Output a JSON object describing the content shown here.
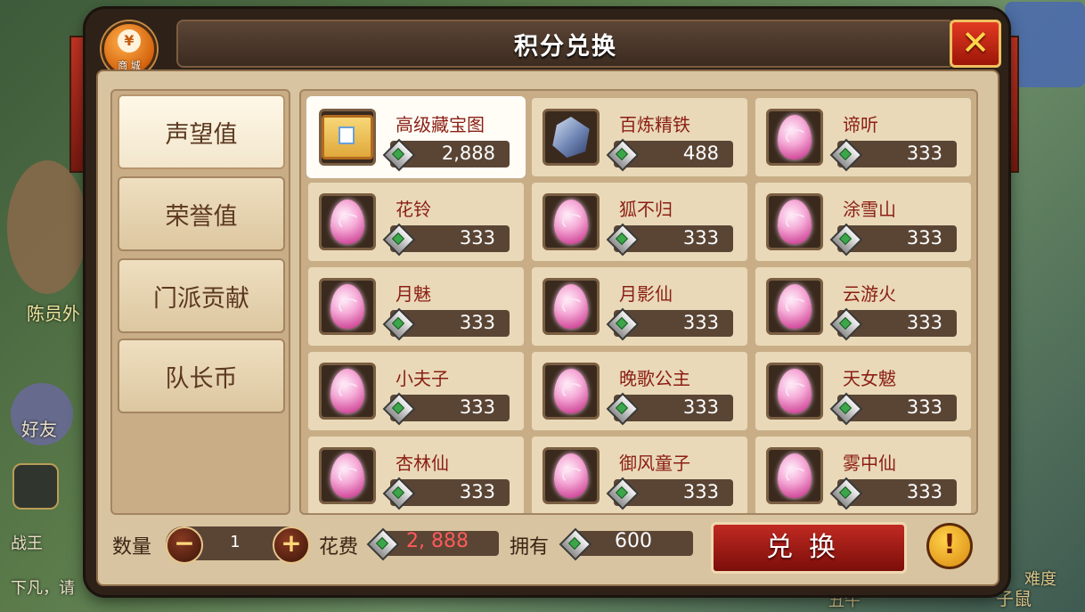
{
  "window": {
    "title": "积分兑换",
    "shop_badge_label": "商 城",
    "close_glyph": "✕"
  },
  "background": {
    "npc_name": "陈员外",
    "friend_label": "好友",
    "chat_line_1": "战王",
    "chat_line_2": "下凡，请",
    "bottom_right_1": "子鼠",
    "bottom_right_2": "难度",
    "bottom_mid": "丑牛"
  },
  "tabs": [
    {
      "label": "声望值",
      "active": true
    },
    {
      "label": "荣誉值",
      "active": false
    },
    {
      "label": "门派贡献",
      "active": false
    },
    {
      "label": "队长币",
      "active": false
    }
  ],
  "items": [
    {
      "name": "高级藏宝图",
      "price": "2,888",
      "icon": "treasure-map-icon",
      "selected": true
    },
    {
      "name": "百炼精铁",
      "price": "488",
      "icon": "refined-iron-icon",
      "selected": false
    },
    {
      "name": "谛听",
      "price": "333",
      "icon": "pet-egg-icon",
      "selected": false
    },
    {
      "name": "花铃",
      "price": "333",
      "icon": "pet-egg-icon",
      "selected": false
    },
    {
      "name": "狐不归",
      "price": "333",
      "icon": "pet-egg-icon",
      "selected": false
    },
    {
      "name": "涂雪山",
      "price": "333",
      "icon": "pet-egg-icon",
      "selected": false
    },
    {
      "name": "月魅",
      "price": "333",
      "icon": "pet-egg-icon",
      "selected": false
    },
    {
      "name": "月影仙",
      "price": "333",
      "icon": "pet-egg-icon",
      "selected": false
    },
    {
      "name": "云游火",
      "price": "333",
      "icon": "pet-egg-icon",
      "selected": false
    },
    {
      "name": "小夫子",
      "price": "333",
      "icon": "pet-egg-icon",
      "selected": false
    },
    {
      "name": "晚歌公主",
      "price": "333",
      "icon": "pet-egg-icon",
      "selected": false
    },
    {
      "name": "天女魃",
      "price": "333",
      "icon": "pet-egg-icon",
      "selected": false
    },
    {
      "name": "杏林仙",
      "price": "333",
      "icon": "pet-egg-icon",
      "selected": false
    },
    {
      "name": "御风童子",
      "price": "333",
      "icon": "pet-egg-icon",
      "selected": false
    },
    {
      "name": "雾中仙",
      "price": "333",
      "icon": "pet-egg-icon",
      "selected": false
    }
  ],
  "footer": {
    "quantity_label": "数量",
    "quantity_value": "1",
    "minus_glyph": "−",
    "plus_glyph": "+",
    "cost_label": "花费",
    "cost_value": "2, 888",
    "own_label": "拥有",
    "own_value": "600",
    "exchange_label": "兑换",
    "info_glyph": "!"
  },
  "colors": {
    "item_name": "#8b1e14",
    "cost_value": "#ff5a5a",
    "exchange_button": "#c02a22",
    "close_button": "#e23a22"
  }
}
